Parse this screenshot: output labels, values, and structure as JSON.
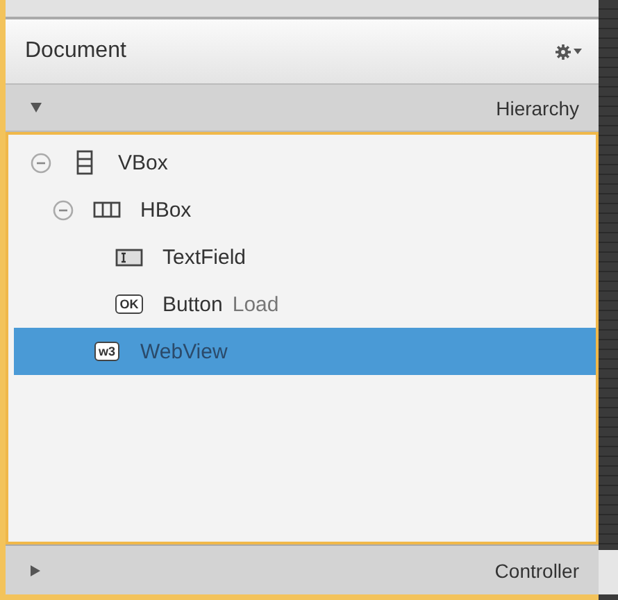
{
  "panel": {
    "title": "Document"
  },
  "sections": [
    {
      "title": "Hierarchy",
      "expanded": true,
      "tree": [
        {
          "label": "VBox",
          "kind": "vbox",
          "expanded": true,
          "selected": false,
          "children": [
            {
              "label": "HBox",
              "kind": "hbox",
              "expanded": true,
              "selected": false,
              "children": [
                {
                  "label": "TextField",
                  "kind": "textfield",
                  "selected": false
                },
                {
                  "label": "Button",
                  "detail": "Load",
                  "kind": "button",
                  "icon_text": "OK",
                  "selected": false
                }
              ]
            },
            {
              "label": "WebView",
              "kind": "webview",
              "icon_text": "w3",
              "selected": true
            }
          ]
        }
      ]
    },
    {
      "title": "Controller",
      "expanded": false
    }
  ]
}
